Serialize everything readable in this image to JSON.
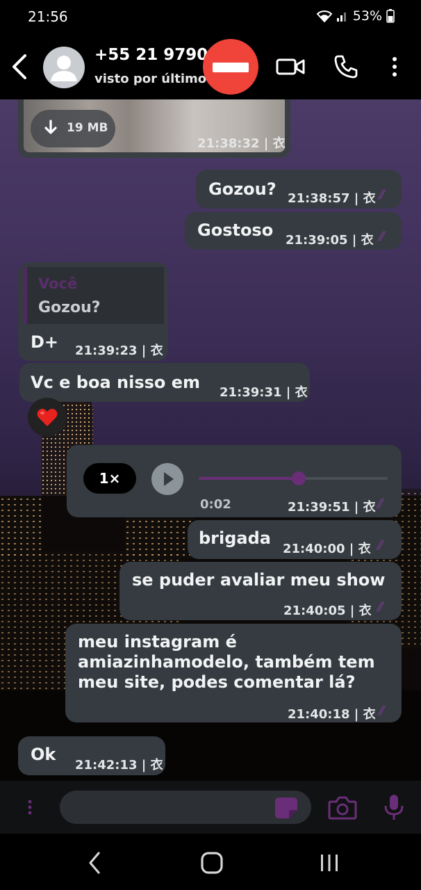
{
  "status_bar": {
    "time": "21:56",
    "battery": "53%"
  },
  "header": {
    "contact_name": "+55 21 9790",
    "last_seen": "visto por último",
    "last_seen_suffix": "."
  },
  "messages": {
    "media": {
      "size": "19 MB",
      "time": "21:38:32 | 衣"
    },
    "m1": {
      "text": "Gozou?",
      "time": "21:38:57 | 衣"
    },
    "m2": {
      "text": "Gostoso",
      "time": "21:39:05 | 衣"
    },
    "m3": {
      "quote_author": "Você",
      "quote_text": "Gozou?",
      "text": "D+",
      "time": "21:39:23 | 衣"
    },
    "m4": {
      "text": "Vc e boa nisso em",
      "time": "21:39:31 | 衣",
      "reaction": "❤️"
    },
    "voice": {
      "speed": "1×",
      "elapsed": "0:02",
      "time": "21:39:51 | 衣",
      "progress": 0.53
    },
    "m5": {
      "text": "brigada",
      "time": "21:40:00 | 衣"
    },
    "m6": {
      "text": "se puder avaliar meu show",
      "time": "21:40:05 | 衣"
    },
    "m7": {
      "line1": "meu instagram é",
      "line2": "amiazinhamodelo, também tem",
      "line3": "meu site, podes comentar lá?",
      "time": "21:40:18 | 衣"
    },
    "m8": {
      "text": "Ok",
      "time": "21:42:13 | 衣"
    }
  },
  "colors": {
    "accent_purple": "#6a2e78",
    "bubble": "#353b40",
    "redaction": "#f0433a"
  },
  "icons": {
    "back": "chevron-left-icon",
    "video": "video-camera-icon",
    "call": "phone-icon",
    "menu": "more-vertical-icon",
    "sticker": "sticker-icon",
    "camera": "camera-icon",
    "mic": "microphone-icon"
  }
}
